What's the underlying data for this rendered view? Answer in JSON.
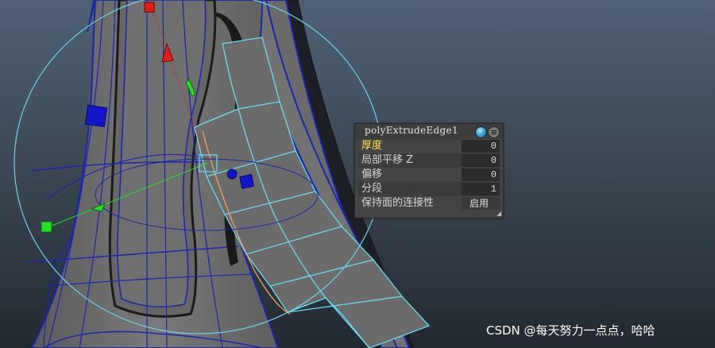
{
  "hud": {
    "title": "polyExtrudeEdge1",
    "rows": [
      {
        "label": "厚度",
        "value": "0"
      },
      {
        "label": "局部平移 Z",
        "value": "0"
      },
      {
        "label": "偏移",
        "value": "0"
      },
      {
        "label": "分段",
        "value": "1"
      },
      {
        "label": "保持面的连接性",
        "value": "启用"
      }
    ]
  },
  "watermark": "CSDN @每天努力一点点，哈哈",
  "colors": {
    "background_top": "#4e6073",
    "background_bottom": "#232a31",
    "mesh_face": "#6f6f6f",
    "wire_blue": "#1b26a8",
    "selected_edge": "#6cdcf0",
    "manip_ring": "#6fd3e8",
    "axis_x": "#e01e1e",
    "axis_y": "#2adf2a",
    "axis_z": "#1216c8",
    "hud_active_label": "#ffe34d"
  }
}
